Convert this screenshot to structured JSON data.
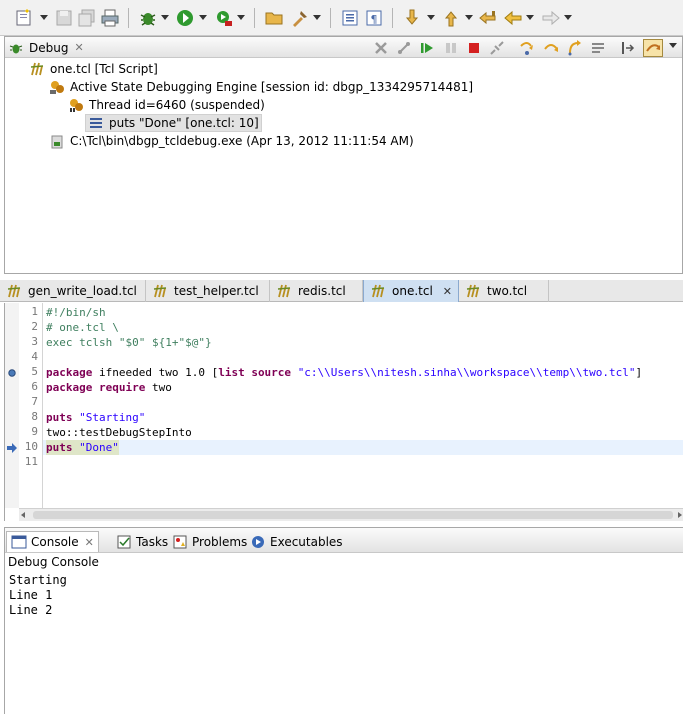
{
  "toolbar": {
    "buttons": [
      "new-icon",
      "save-icon",
      "save-all-icon",
      "print-icon",
      "debug-icon",
      "run-icon",
      "external-tools-icon",
      "open-folder-icon",
      "open-type-icon",
      "toggle-view-icon",
      "show-whitespace-icon",
      "next-annotation-icon",
      "prev-annotation-icon",
      "last-edit-icon",
      "back-icon",
      "forward-icon"
    ]
  },
  "debug_view": {
    "title": "Debug",
    "tree": {
      "launch": "one.tcl [Tcl Script]",
      "engine": "Active State Debugging Engine [session id: dbgp_1334295714481]",
      "thread": "Thread id=6460 (suspended)",
      "frame": "puts \"Done\" [one.tcl: 10]",
      "process": "C:\\Tcl\\bin\\dbgp_tcldebug.exe (Apr 13, 2012 11:11:54 AM)"
    }
  },
  "editor": {
    "tabs": [
      {
        "label": "gen_write_load.tcl",
        "active": false
      },
      {
        "label": "test_helper.tcl",
        "active": false
      },
      {
        "label": "redis.tcl",
        "active": false
      },
      {
        "label": "one.tcl",
        "active": true
      },
      {
        "label": "two.tcl",
        "active": false
      }
    ],
    "line_numbers": [
      "1",
      "2",
      "3",
      "4",
      "5",
      "6",
      "7",
      "8",
      "9",
      "10",
      "11"
    ],
    "lines": {
      "l1": "#!/bin/sh",
      "l2": "# one.tcl \\",
      "l3": "exec tclsh \"$0\" ${1+\"$@\"}",
      "l5_kw": "package",
      "l5_mid": " ifneeded two 1.0 [",
      "l5_kw2": "list source",
      "l5_sp": " ",
      "l5_str": "\"c:\\\\Users\\\\nitesh.sinha\\\\workspace\\\\temp\\\\two.tcl\"",
      "l5_end": "]",
      "l6_kw": "package require",
      "l6_rest": " two",
      "l8_kw": "puts",
      "l8_sp": " ",
      "l8_str": "\"Starting\"",
      "l9": "two::testDebugStepInto",
      "l10_kw": "puts",
      "l10_sp": " ",
      "l10_str": "\"Done\""
    },
    "current_line": "10"
  },
  "console_view": {
    "tabs": [
      "Console",
      "Tasks",
      "Problems",
      "Executables"
    ],
    "title": "Debug Console",
    "lines": [
      "Starting",
      "Line 1",
      "Line 2"
    ]
  },
  "colors": {
    "keyword": "#7f0055",
    "comment": "#3f7f5f",
    "string": "#2a00ff",
    "current_line_bg": "#e8f2fe"
  }
}
